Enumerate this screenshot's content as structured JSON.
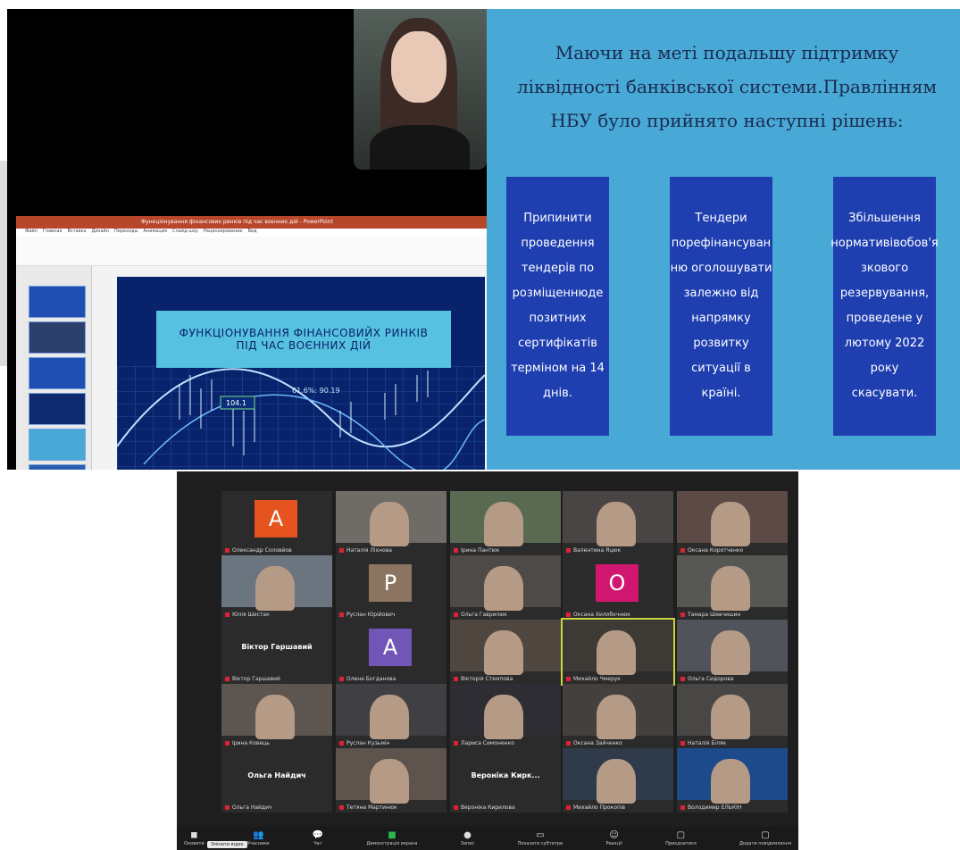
{
  "top_left": {
    "ppt_window_title": "Функціонування фінансових ринків під час воєнних дій - PowerPoint",
    "ppt_tabs": [
      "Файл",
      "Главная",
      "Вставка",
      "Дизайн",
      "Переходы",
      "Анимация",
      "Слайд-шоу",
      "Рецензирование",
      "Вид"
    ],
    "slide_title_line1": "ФУНКЦІОНУВАННЯ ФІНАНСОВИЙХ РИНКІВ",
    "slide_title_line2": "ПІД ЧАС ВОЄННИХ ДІЙ",
    "graph_label_1": "104.1",
    "graph_label_2": "61.6%: 90.19"
  },
  "top_right": {
    "heading_line1": "Маючи на меті подальшу підтримку",
    "heading_line2": "ліквідності банківської системи.Правлінням",
    "heading_line3": "НБУ було прийнято наступні рішень:",
    "box1": "Припинити\nпроведення\nтендерів по\nрозміщеннюде\nпозитних\nсертифікатів\nтерміном на 14\nднів.",
    "box2": "Тендери\nпорефінансуван\nню оголошувати\nзалежно від\nнапрямку\nрозвитку\nситуації в\nкраїні.",
    "box3": "Збільшення\nнормативівобов'я\nзкового\nрезервування,\nпроведене у\nлютому 2022 року\nскасувати."
  },
  "zoom": {
    "participants": [
      {
        "name": "Олександр Соловйов",
        "initial": "А",
        "color": "#e5531f"
      },
      {
        "name": "Наталія Ліхнова",
        "video": "#6f6b66"
      },
      {
        "name": "Ірина Пантюк",
        "video": "#5a6a52"
      },
      {
        "name": "Валентина Яцюк",
        "video": "#4a4545"
      },
      {
        "name": "Оксана Коротченко",
        "video": "#5b4a46"
      },
      {
        "name": "Юлія Шестак",
        "video": "#6a7580"
      },
      {
        "name": "Руслан Юрійович",
        "initial": "Р",
        "color": "#8c7560"
      },
      {
        "name": "Ольга Гаврилюк",
        "video": "#4d4a48"
      },
      {
        "name": "Оксана Хилобочнюк",
        "initial": "О",
        "color": "#d0166e"
      },
      {
        "name": "Тамара Шевчишин",
        "video": "#575753"
      },
      {
        "name": "Віктор Гаршавий",
        "bigname": "Віктор Гаршавий"
      },
      {
        "name": "Олена Богданова",
        "initial": "А",
        "color": "#7156b8"
      },
      {
        "name": "Вікторія Стемпова",
        "video": "#4f463f"
      },
      {
        "name": "Михайло Чмерук",
        "video": "#3d3a36",
        "hl": true
      },
      {
        "name": "Ольга Сидорова",
        "video": "#50545a"
      },
      {
        "name": "Ірина Ковець",
        "video": "#5c5550"
      },
      {
        "name": "Руслан Кузьмін",
        "video": "#3f3f44"
      },
      {
        "name": "Лариса Симоненко",
        "video": "#2d2d33"
      },
      {
        "name": "Оксана Зайченко",
        "video": "#43403e"
      },
      {
        "name": "Наталія Біляк",
        "video": "#494746"
      },
      {
        "name": "Ольга Найдич",
        "bigname": "Ольга Найдич"
      },
      {
        "name": "Тетяна Мартинюк",
        "video": "#5e534d"
      },
      {
        "name": "Вероніка Кирилова",
        "bigname": "Вероніка Кирк..."
      },
      {
        "name": "Михайло Прокопів",
        "video": "#2f3a4a"
      },
      {
        "name": "Володимир ЕЛЬКІН",
        "video": "#1d4a8a"
      }
    ],
    "toolbar": [
      {
        "label": "Оновити",
        "icon": "◼"
      },
      {
        "label": "Учасники",
        "icon": "👥"
      },
      {
        "label": "Чат",
        "icon": "💬"
      },
      {
        "label": "Демонстрація екрана",
        "icon": "■",
        "green": true
      },
      {
        "label": "Запис",
        "icon": "●"
      },
      {
        "label": "Показати субтитри",
        "icon": "▭"
      },
      {
        "label": "Реакції",
        "icon": "☺"
      },
      {
        "label": "Приєднатися",
        "icon": "▢"
      },
      {
        "label": "Додати повідомлення",
        "icon": "▢"
      }
    ],
    "tooltip": "Змінити відео"
  }
}
